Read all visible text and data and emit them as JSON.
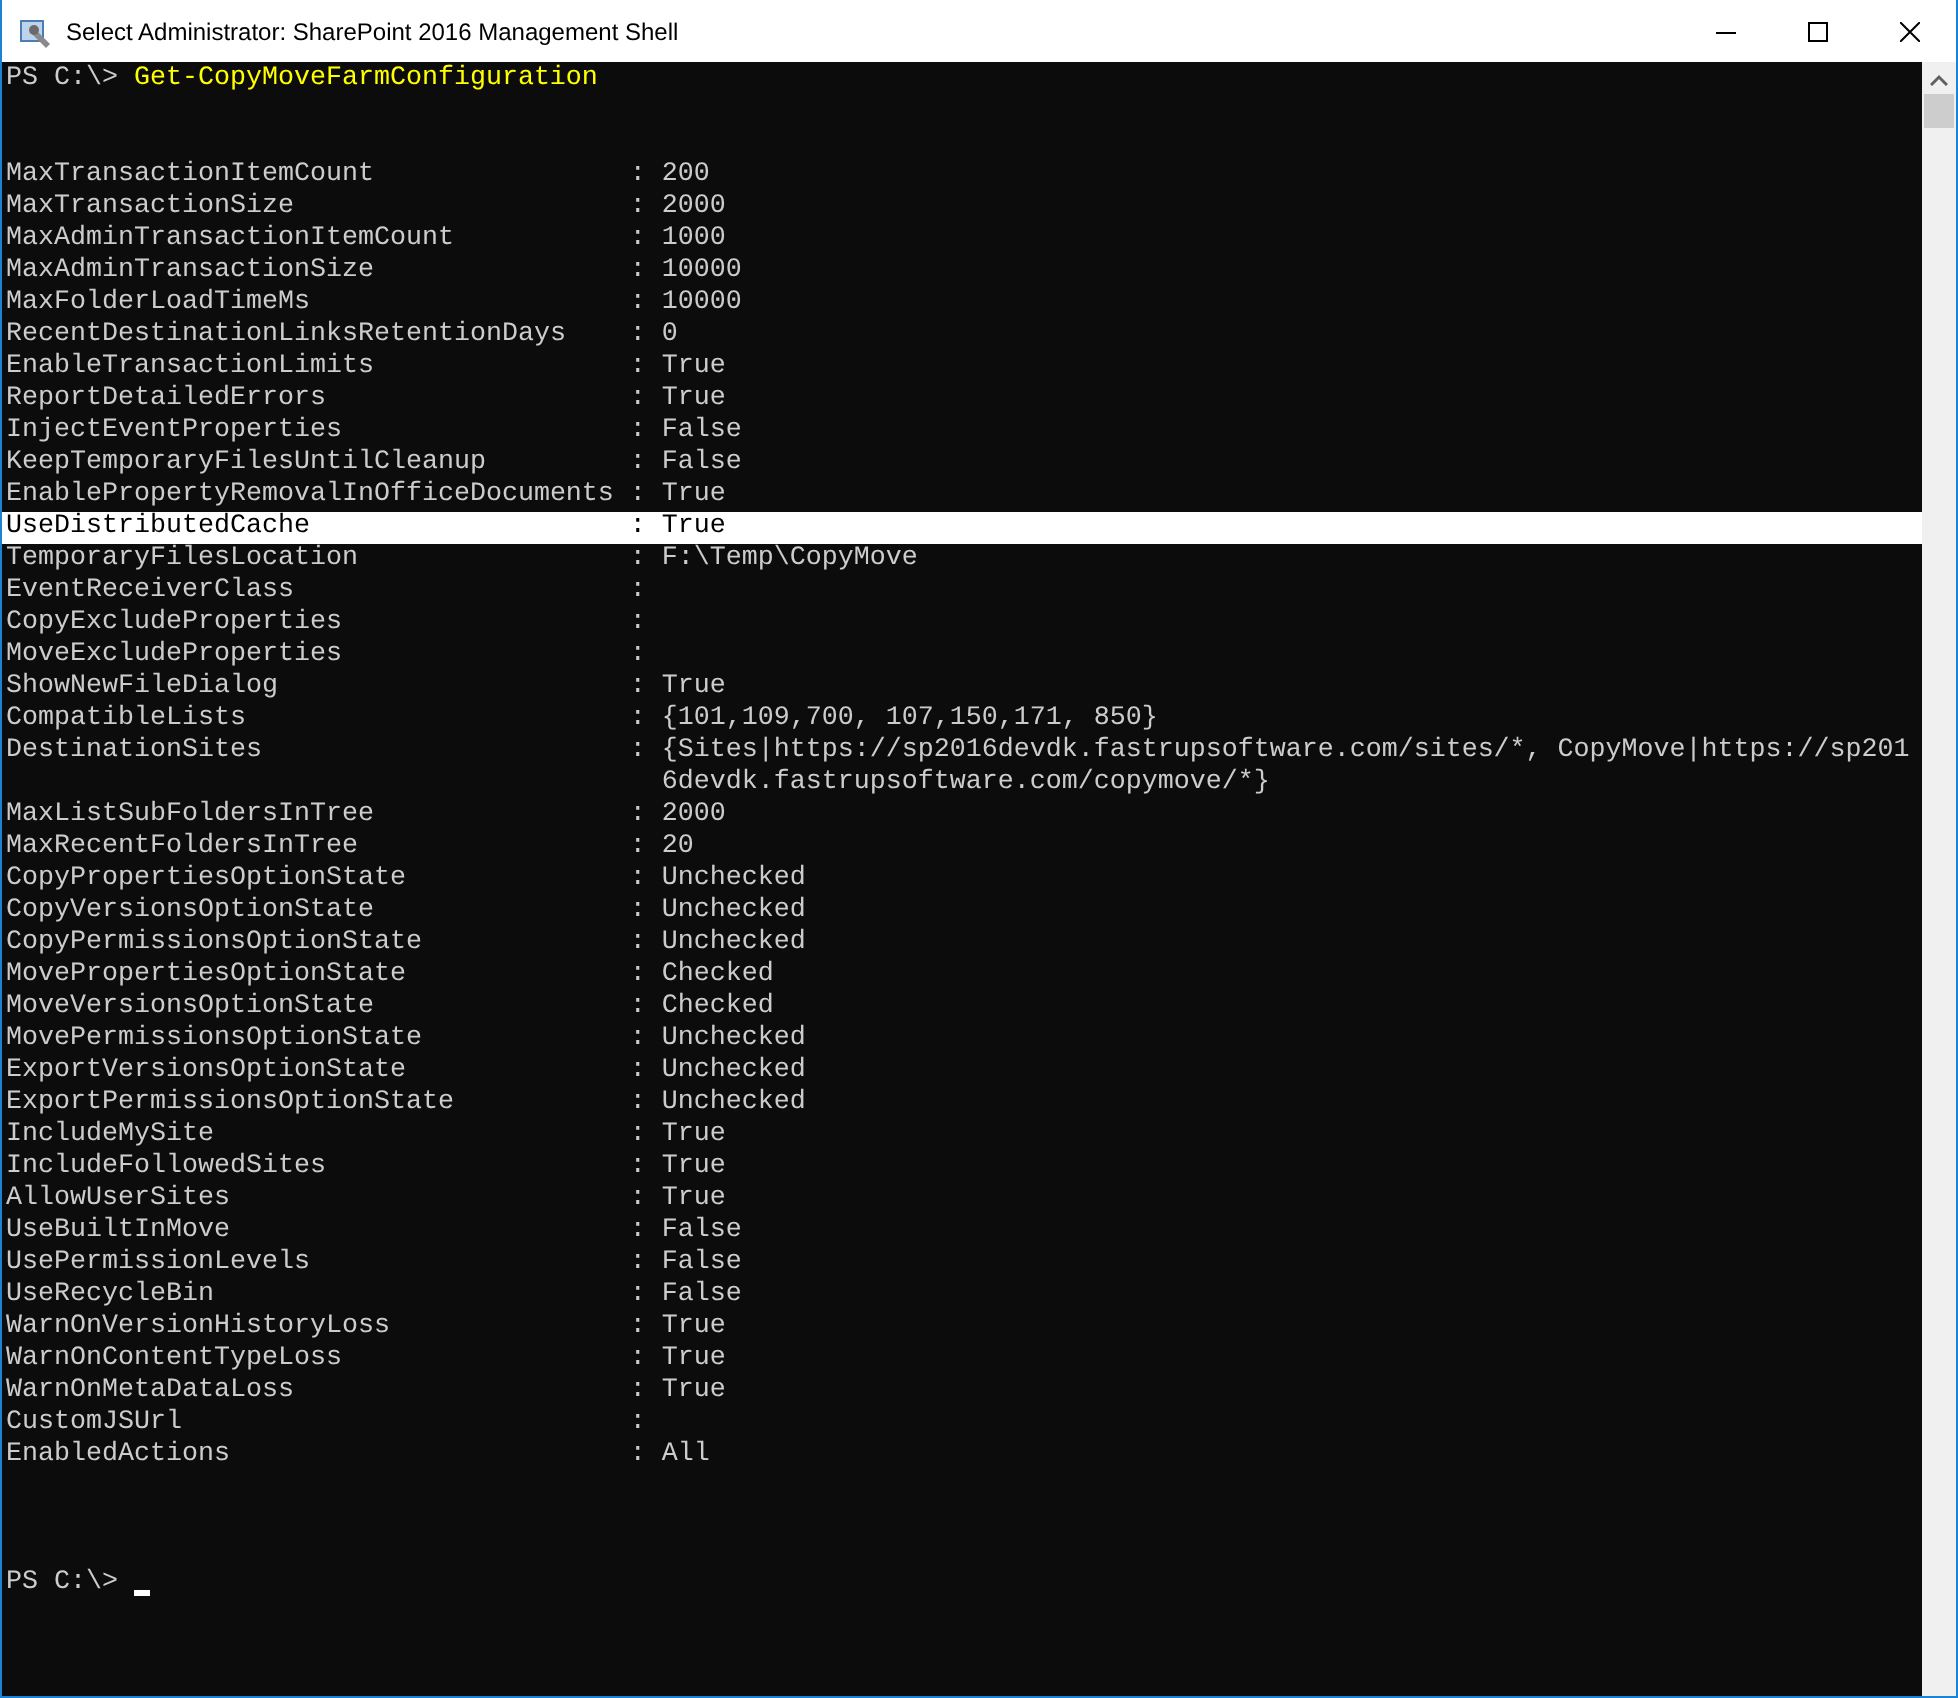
{
  "window": {
    "title": "Select Administrator: SharePoint 2016 Management Shell"
  },
  "console": {
    "prompt": "PS C:\\>",
    "command": "Get-CopyMoveFarmConfiguration",
    "separator": ":",
    "rows": [
      {
        "name": "MaxTransactionItemCount",
        "value": "200",
        "selected": false
      },
      {
        "name": "MaxTransactionSize",
        "value": "2000",
        "selected": false
      },
      {
        "name": "MaxAdminTransactionItemCount",
        "value": "1000",
        "selected": false
      },
      {
        "name": "MaxAdminTransactionSize",
        "value": "10000",
        "selected": false
      },
      {
        "name": "MaxFolderLoadTimeMs",
        "value": "10000",
        "selected": false
      },
      {
        "name": "RecentDestinationLinksRetentionDays",
        "value": "0",
        "selected": false
      },
      {
        "name": "EnableTransactionLimits",
        "value": "True",
        "selected": false
      },
      {
        "name": "ReportDetailedErrors",
        "value": "True",
        "selected": false
      },
      {
        "name": "InjectEventProperties",
        "value": "False",
        "selected": false
      },
      {
        "name": "KeepTemporaryFilesUntilCleanup",
        "value": "False",
        "selected": false
      },
      {
        "name": "EnablePropertyRemovalInOfficeDocuments",
        "value": "True",
        "selected": false
      },
      {
        "name": "UseDistributedCache",
        "value": "True",
        "selected": true
      },
      {
        "name": "TemporaryFilesLocation",
        "value": "F:\\Temp\\CopyMove",
        "selected": false
      },
      {
        "name": "EventReceiverClass",
        "selected": false
      },
      {
        "name": "CopyExcludeProperties",
        "selected": false
      },
      {
        "name": "MoveExcludeProperties",
        "selected": false
      },
      {
        "name": "ShowNewFileDialog",
        "value": "True",
        "selected": false
      },
      {
        "name": "CompatibleLists",
        "value": "{101,109,700, 107,150,171, 850}",
        "selected": false
      },
      {
        "name": "DestinationSites",
        "value": "{Sites|https://sp2016devdk.fastrupsoftware.com/sites/*, CopyMove|https://sp2016devdk.fastrupsoftware.com/copymove/*}",
        "selected": false
      },
      {
        "name": "MaxListSubFoldersInTree",
        "value": "2000",
        "selected": false
      },
      {
        "name": "MaxRecentFoldersInTree",
        "value": "20",
        "selected": false
      },
      {
        "name": "CopyPropertiesOptionState",
        "value": "Unchecked",
        "selected": false
      },
      {
        "name": "CopyVersionsOptionState",
        "value": "Unchecked",
        "selected": false
      },
      {
        "name": "CopyPermissionsOptionState",
        "value": "Unchecked",
        "selected": false
      },
      {
        "name": "MovePropertiesOptionState",
        "value": "Checked",
        "selected": false
      },
      {
        "name": "MoveVersionsOptionState",
        "value": "Checked",
        "selected": false
      },
      {
        "name": "MovePermissionsOptionState",
        "value": "Unchecked",
        "selected": false
      },
      {
        "name": "ExportVersionsOptionState",
        "value": "Unchecked",
        "selected": false
      },
      {
        "name": "ExportPermissionsOptionState",
        "value": "Unchecked",
        "selected": false
      },
      {
        "name": "IncludeMySite",
        "value": "True",
        "selected": false
      },
      {
        "name": "IncludeFollowedSites",
        "value": "True",
        "selected": false
      },
      {
        "name": "AllowUserSites",
        "value": "True",
        "selected": false
      },
      {
        "name": "UseBuiltInMove",
        "value": "False",
        "selected": false
      },
      {
        "name": "UsePermissionLevels",
        "value": "False",
        "selected": false
      },
      {
        "name": "UseRecycleBin",
        "value": "False",
        "selected": false
      },
      {
        "name": "WarnOnVersionHistoryLoss",
        "value": "True",
        "selected": false
      },
      {
        "name": "WarnOnContentTypeLoss",
        "value": "True",
        "selected": false
      },
      {
        "name": "WarnOnMetaDataLoss",
        "value": "True",
        "selected": false
      },
      {
        "name": "CustomJSUrl",
        "selected": false
      },
      {
        "name": "EnabledActions",
        "value": "All",
        "selected": false
      }
    ],
    "end_prompt": "PS C:\\>"
  }
}
